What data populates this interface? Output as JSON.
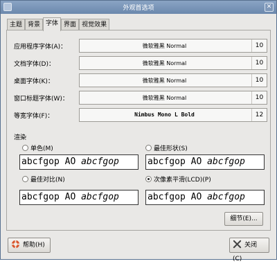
{
  "window": {
    "title": "外观首选项",
    "close_glyph": "✕"
  },
  "tabs": [
    {
      "label": "主题"
    },
    {
      "label": "背景"
    },
    {
      "label": "字体"
    },
    {
      "label": "界面"
    },
    {
      "label": "视觉效果"
    }
  ],
  "active_tab": "字体",
  "fonts": [
    {
      "label": "应用程序字体(A)：",
      "font": "微软雅黑 Normal",
      "size": "10"
    },
    {
      "label": "文档字体(D)：",
      "font": "微软雅黑 Normal",
      "size": "10"
    },
    {
      "label": "桌面字体(K)：",
      "font": "微软雅黑 Normal",
      "size": "10"
    },
    {
      "label": "窗口标题字体(W)：",
      "font": "微软雅黑 Normal",
      "size": "10"
    },
    {
      "label": "等宽字体(F)：",
      "font": "Nimbus Mono L Bold",
      "size": "12"
    }
  ],
  "rendering": {
    "title": "渲染",
    "options": [
      {
        "label": "单色(M)",
        "selected": false
      },
      {
        "label": "最佳形状(S)",
        "selected": false
      },
      {
        "label": "最佳对比(N)",
        "selected": false
      },
      {
        "label": "次像素平滑(LCD)(P)",
        "selected": true
      }
    ],
    "sample_regular": "abcfgop AO ",
    "sample_italic": "abcfgop"
  },
  "buttons": {
    "details": "细节(E)...",
    "help": "帮助(H)",
    "close": "关闭(C)"
  },
  "colors": {
    "titlebar": "#6b88ad",
    "window_bg": "#e9e8e6",
    "help_icon": "#d9542c",
    "close_icon": "#444444"
  },
  "icons": {
    "help": "lifebuoy-icon",
    "close": "close-x-icon",
    "window_close": "close-icon"
  }
}
